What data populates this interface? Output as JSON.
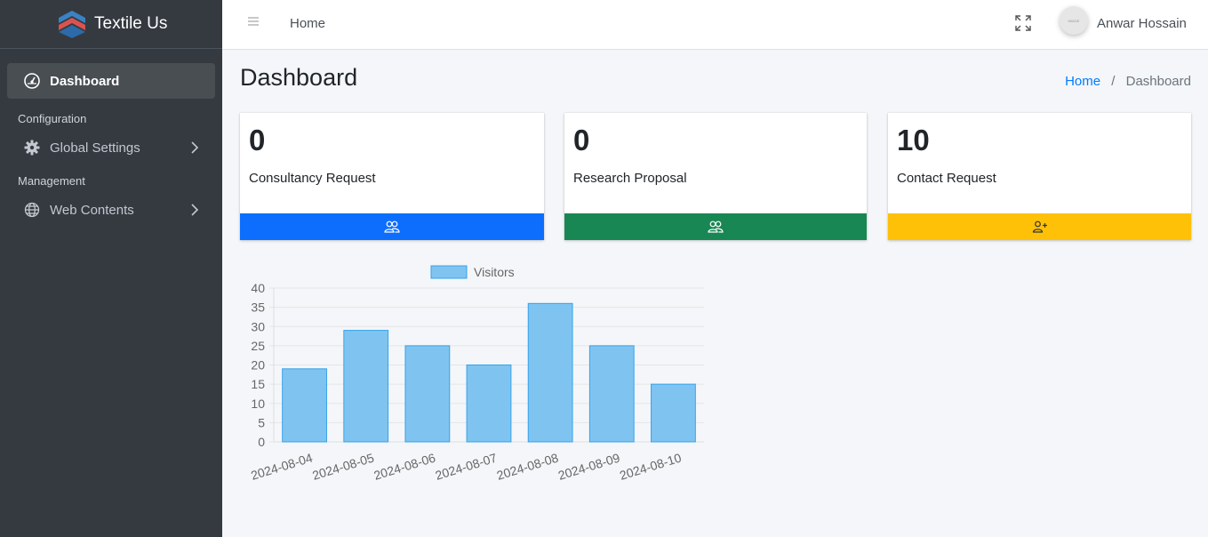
{
  "brand": {
    "name": "Textile Us"
  },
  "sidebar": {
    "active": {
      "label": "Dashboard",
      "icon": "gauge-icon"
    },
    "sections": [
      {
        "header": "Configuration",
        "item": {
          "label": "Global Settings",
          "icon": "gear-icon"
        }
      },
      {
        "header": "Management",
        "item": {
          "label": "Web Contents",
          "icon": "globe-icon"
        }
      }
    ]
  },
  "topbar": {
    "home_label": "Home",
    "user_name": "Anwar Hossain",
    "avatar_text": "IMAGE"
  },
  "page": {
    "title": "Dashboard",
    "breadcrumb": {
      "home": "Home",
      "separator": "/",
      "current": "Dashboard"
    }
  },
  "cards": [
    {
      "count": "0",
      "label": "Consultancy Request",
      "color": "#0d6efd",
      "icon": "users-icon"
    },
    {
      "count": "0",
      "label": "Research Proposal",
      "color": "#198754",
      "icon": "users-icon"
    },
    {
      "count": "10",
      "label": "Contact Request",
      "color": "#ffc107",
      "icon": "user-plus-icon"
    }
  ],
  "chart_data": {
    "type": "bar",
    "categories": [
      "2024-08-04",
      "2024-08-05",
      "2024-08-06",
      "2024-08-07",
      "2024-08-08",
      "2024-08-09",
      "2024-08-10"
    ],
    "series": [
      {
        "name": "Visitors",
        "values": [
          19,
          29,
          25,
          20,
          36,
          25,
          15
        ]
      }
    ],
    "ylim": [
      0,
      40
    ],
    "yticks": [
      0,
      5,
      10,
      15,
      20,
      25,
      30,
      35,
      40
    ],
    "legend": "top",
    "grid": true,
    "bar_fill": "#7fc4f0",
    "bar_stroke": "#36a2eb"
  }
}
